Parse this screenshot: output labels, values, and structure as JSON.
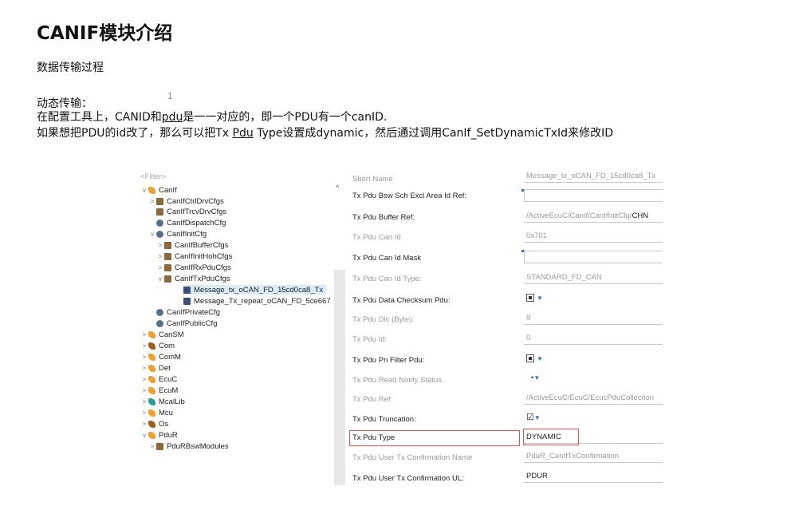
{
  "slide": {
    "title": "CANIF模块介绍",
    "subtitle": "数据传输过程",
    "slide_number": "1",
    "heading": "动态传输：",
    "line2_pre": "在配置工具上，CANID和",
    "line2_ul": "pdu",
    "line2_post": "是一一对应的，即一个PDU有一个canID.",
    "line3_pre": "如果想把PDU的id改了，那么可以把Tx ",
    "line3_ul": "Pdu",
    "line3_post": " Type设置成dynamic，然后通过调用CanIf_SetDynamicTxId来修改ID"
  },
  "tree": {
    "filter_placeholder": "<Filter>",
    "items": [
      {
        "label": "CanIf"
      },
      {
        "label": "CanIfCtrlDrvCfgs"
      },
      {
        "label": "CanIfTrcvDrvCfgs"
      },
      {
        "label": "CanIfDispatchCfg"
      },
      {
        "label": "CanIfInitCfg"
      },
      {
        "label": "CanIfBufferCfgs"
      },
      {
        "label": "CanIfInitHohCfgs"
      },
      {
        "label": "CanIfRxPduCfgs"
      },
      {
        "label": "CanIfTxPduCfgs"
      },
      {
        "label": "Message_tx_oCAN_FD_15cd0ca8_Tx"
      },
      {
        "label": "Message_Tx_repeat_oCAN_FD_5ce667"
      },
      {
        "label": "CanIfPrivateCfg"
      },
      {
        "label": "CanIfPublicCfg"
      },
      {
        "label": "CanSM"
      },
      {
        "label": "Com"
      },
      {
        "label": "ComM"
      },
      {
        "label": "Det"
      },
      {
        "label": "EcuC"
      },
      {
        "label": "EcuM"
      },
      {
        "label": "McalLib"
      },
      {
        "label": "Mcu"
      },
      {
        "label": "Os"
      },
      {
        "label": "PduR"
      },
      {
        "label": "PduRBswModules"
      }
    ]
  },
  "props": {
    "short_name_label": "Short Name",
    "short_name_value": "Message_tx_oCAN_FD_15cd0ca8_Tx",
    "bsw_label": "Tx Pdu Bsw Sch Excl Area Id Ref:",
    "buffer_label": "Tx Pdu Buffer Ref:",
    "buffer_value_a": "/ActiveEcuC/CanIf/CanIfInitCfg/",
    "buffer_value_b": "CHN",
    "canid_label": "Tx Pdu Can Id",
    "canid_value": "0x701",
    "mask_label": "Tx Pdu Can Id Mask",
    "idtype_label": "Tx Pdu Can Id Type:",
    "idtype_value": "STANDARD_FD_CAN",
    "checksum_label": "Tx Pdu Data Checksum Pdu:",
    "dlc_label": "Tx Pdu Dlc (Byte):",
    "dlc_value": "8",
    "id_label": "Tx Pdu Id:",
    "id_value": "0",
    "pnfilter_label": "Tx Pdu Pn Filter Pdu:",
    "notify_label": "Tx Pdu Read Notify Status",
    "ref_label": "Tx Pdu Ref:",
    "ref_value": "/ActiveEcuC/EcuC/EcucPduCollection",
    "trunc_label": "Tx Pdu Truncation:",
    "type_label": "Tx Pdu Type",
    "type_value": "DYNAMIC",
    "confname_label": "Tx Pdu User Tx Confirmation Name",
    "confname_value": "PduR_CanIfTxConfirmation",
    "confui_label": "Tx Pdu User Tx Confirmation UL:",
    "confui_value": "PDUR"
  },
  "colors": {
    "highlight": "#d9534f",
    "selection": "#dcebfa"
  }
}
